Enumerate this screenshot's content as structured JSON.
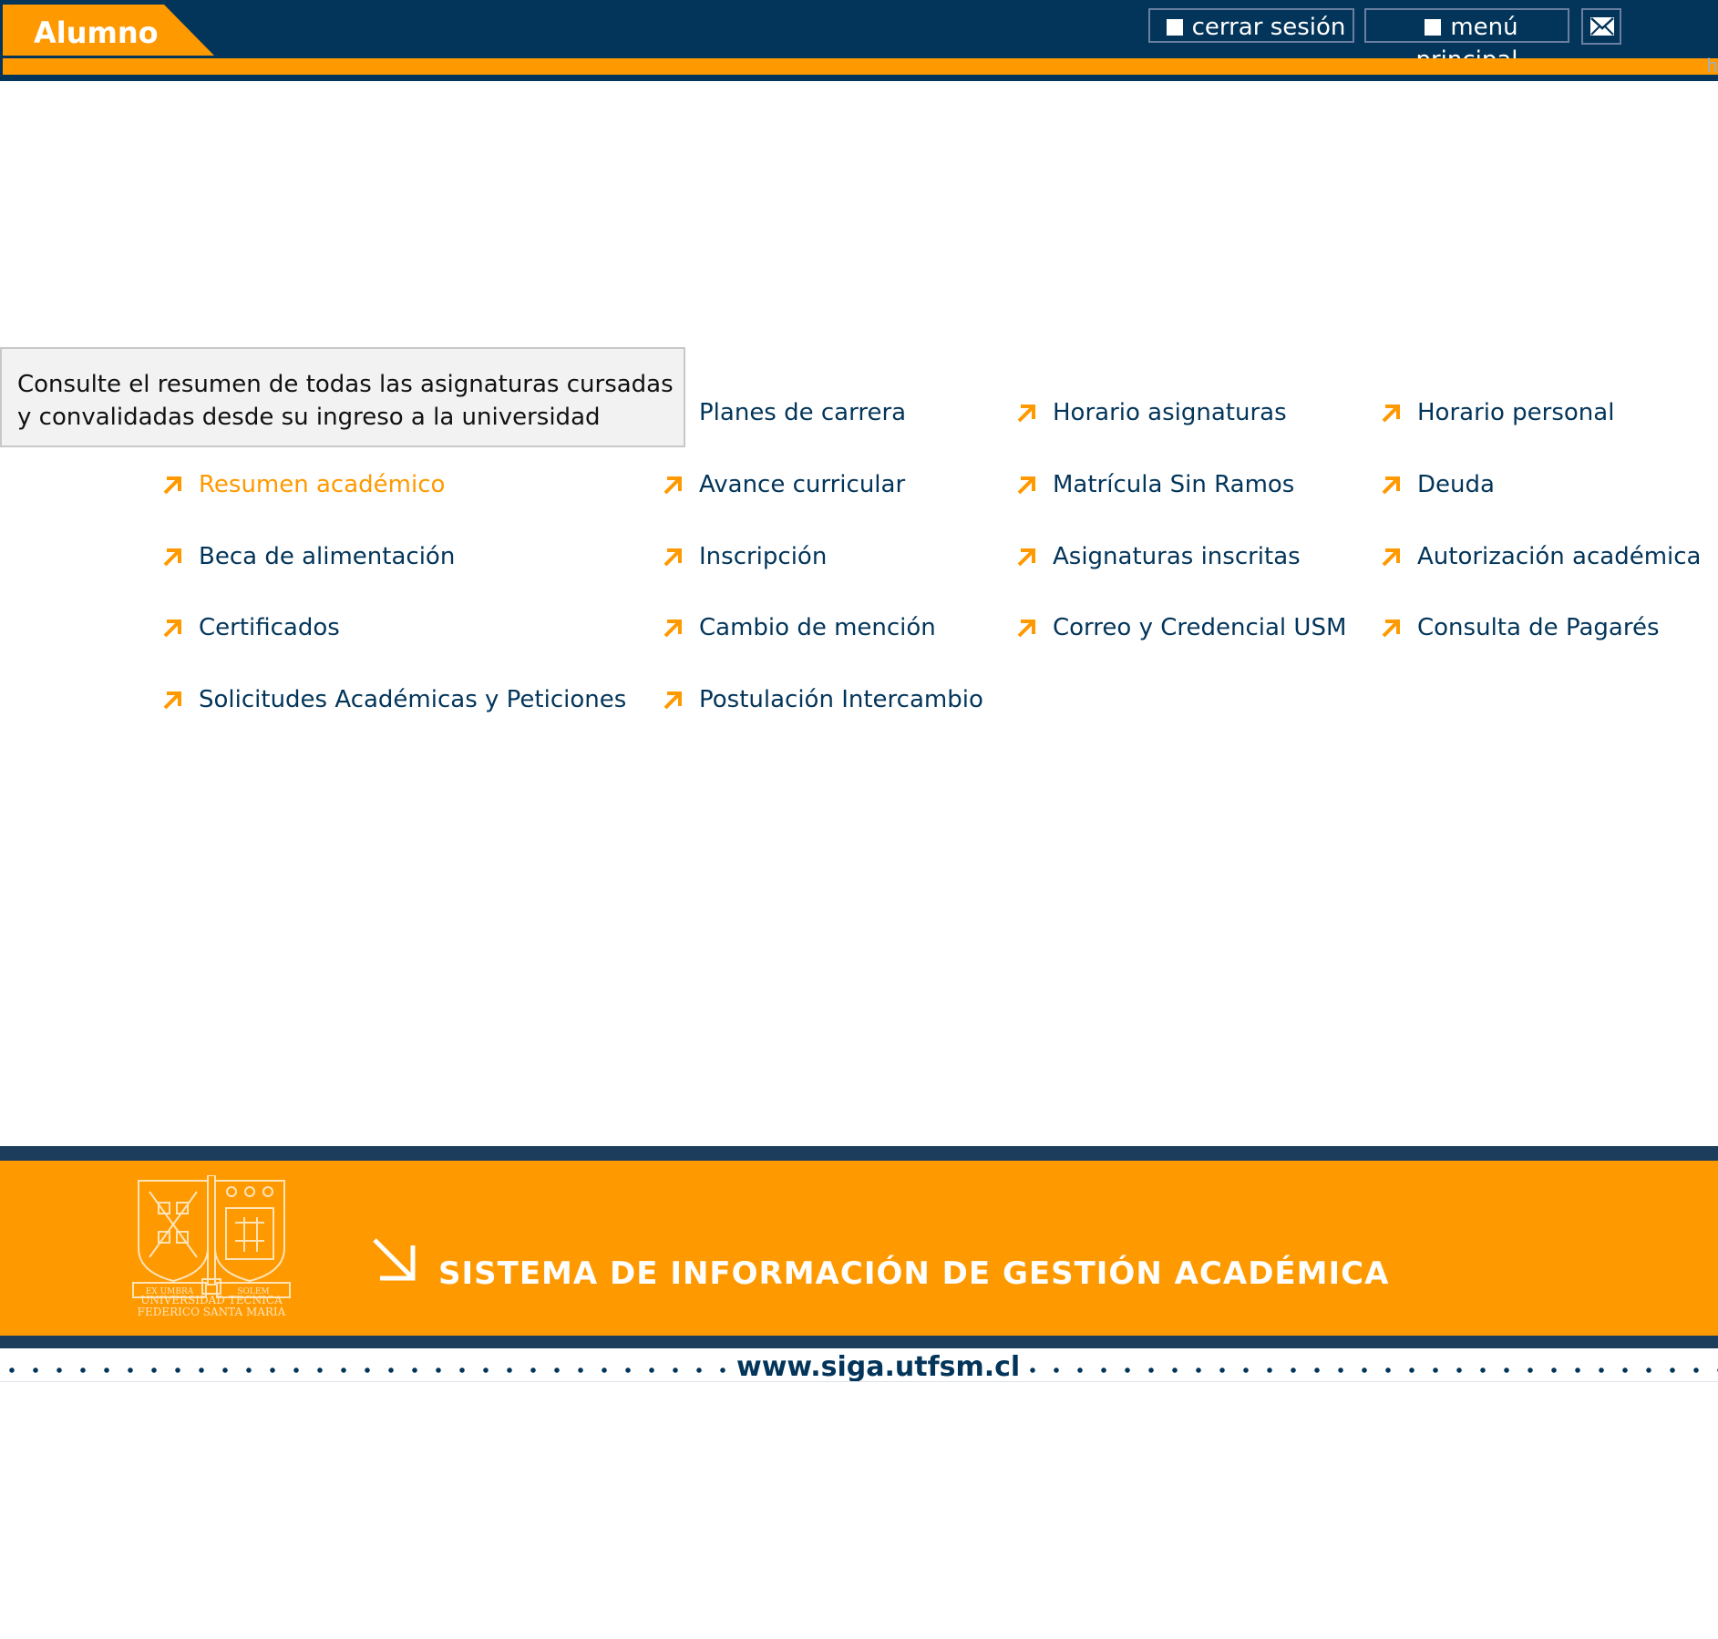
{
  "header": {
    "role_label": "Alumno",
    "logout_label": "cerrar sesión",
    "main_menu_label": "menú principal",
    "mail_icon": "mail-icon",
    "corner_text": "h",
    "colors": {
      "navy": "#03355a",
      "orange": "#ff9900"
    }
  },
  "tooltip": {
    "text": "Consulte el resumen de todas las asignaturas cursadas y convalidadas desde su ingreso a la universidad"
  },
  "menu": {
    "arrow_icon": "arrow-up-right-icon",
    "items": [
      {
        "label": "Planes de carrera",
        "active": false
      },
      {
        "label": "Horario asignaturas",
        "active": false
      },
      {
        "label": "Horario personal",
        "active": false
      },
      {
        "label": "Resumen académico",
        "active": true
      },
      {
        "label": "Avance curricular",
        "active": false
      },
      {
        "label": "Matrícula Sin Ramos",
        "active": false
      },
      {
        "label": "Deuda",
        "active": false
      },
      {
        "label": "Beca de alimentación",
        "active": false
      },
      {
        "label": "Inscripción",
        "active": false
      },
      {
        "label": "Asignaturas inscritas",
        "active": false
      },
      {
        "label": "Autorización académica",
        "active": false
      },
      {
        "label": "Certificados",
        "active": false
      },
      {
        "label": "Cambio de mención",
        "active": false
      },
      {
        "label": "Correo y Credencial USM",
        "active": false
      },
      {
        "label": "Consulta de Pagarés",
        "active": false
      },
      {
        "label": "Solicitudes Académicas y Peticiones",
        "active": false
      },
      {
        "label": "Postulación Intercambio",
        "active": false
      }
    ]
  },
  "footer": {
    "crest_motto_left": "EX UMBRA",
    "crest_motto_right": "SOLEM",
    "university_line1": "UNIVERSIDAD TECNICA",
    "university_line2": "FEDERICO SANTA MARIA",
    "title": "SISTEMA DE INFORMACIÓN DE GESTIÓN ACADÉMICA",
    "url": "www.siga.utfsm.cl",
    "arrow_icon": "arrow-down-right-icon"
  }
}
